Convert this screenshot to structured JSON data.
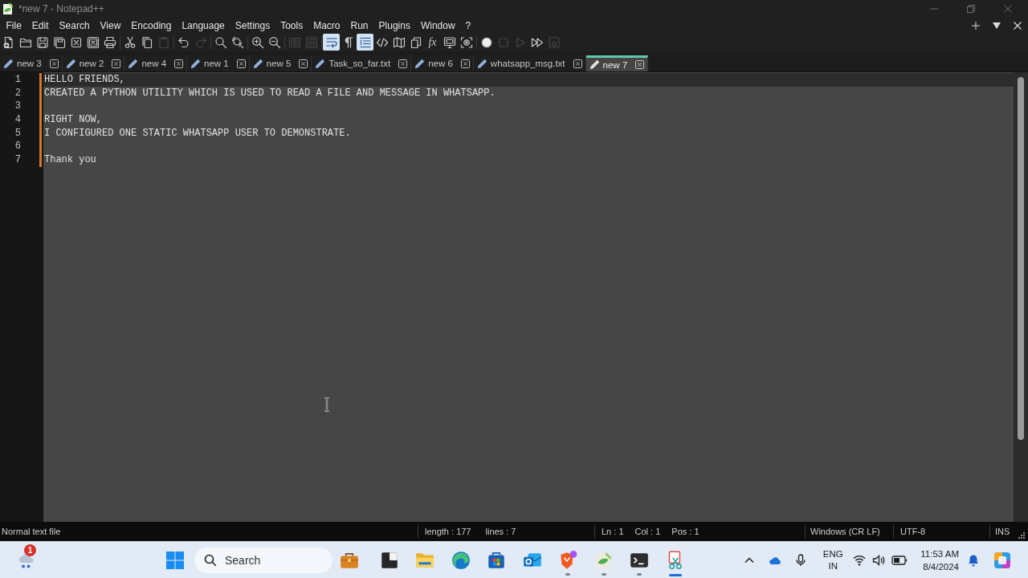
{
  "window": {
    "title": "*new 7 - Notepad++"
  },
  "menu": [
    "File",
    "Edit",
    "Search",
    "View",
    "Encoding",
    "Language",
    "Settings",
    "Tools",
    "Macro",
    "Run",
    "Plugins",
    "Window",
    "?"
  ],
  "toolbar": {
    "groups": [
      {
        "buttons": [
          {
            "kind": "new",
            "on": false,
            "disabled": false
          },
          {
            "kind": "open",
            "on": false,
            "disabled": false
          },
          {
            "kind": "save",
            "on": false,
            "disabled": false
          },
          {
            "kind": "saveall",
            "on": false,
            "disabled": false
          },
          {
            "kind": "close",
            "on": false,
            "disabled": false
          },
          {
            "kind": "closeall",
            "on": false,
            "disabled": false
          },
          {
            "kind": "print",
            "on": false,
            "disabled": false
          }
        ]
      },
      {
        "buttons": [
          {
            "kind": "cut",
            "on": false,
            "disabled": false
          },
          {
            "kind": "copy",
            "on": false,
            "disabled": false
          },
          {
            "kind": "paste",
            "on": false,
            "disabled": true
          }
        ]
      },
      {
        "buttons": [
          {
            "kind": "undo",
            "on": false,
            "disabled": false
          },
          {
            "kind": "redo",
            "on": false,
            "disabled": true
          }
        ]
      },
      {
        "buttons": [
          {
            "kind": "find",
            "on": false,
            "disabled": false
          },
          {
            "kind": "replace",
            "on": false,
            "disabled": false
          }
        ]
      },
      {
        "buttons": [
          {
            "kind": "zoomin",
            "on": false,
            "disabled": false
          },
          {
            "kind": "zoomout",
            "on": false,
            "disabled": false
          }
        ]
      },
      {
        "buttons": [
          {
            "kind": "syncv",
            "on": false,
            "disabled": true
          },
          {
            "kind": "synch",
            "on": false,
            "disabled": true
          }
        ]
      },
      {
        "buttons": [
          {
            "kind": "wrap",
            "on": true,
            "disabled": false
          },
          {
            "kind": "allchars",
            "on": false,
            "disabled": false
          },
          {
            "kind": "indent",
            "on": true,
            "disabled": false
          },
          {
            "kind": "udl",
            "on": false,
            "disabled": false
          },
          {
            "kind": "docmap",
            "on": false,
            "disabled": false
          },
          {
            "kind": "doclist",
            "on": false,
            "disabled": false
          },
          {
            "kind": "funclist",
            "label": "fx",
            "on": false,
            "disabled": false
          },
          {
            "kind": "monitor",
            "on": false,
            "disabled": false
          },
          {
            "kind": "monitoreye",
            "on": false,
            "disabled": false
          }
        ]
      },
      {
        "buttons": [
          {
            "kind": "record",
            "on": false,
            "disabled": false
          },
          {
            "kind": "stop",
            "on": false,
            "disabled": true
          },
          {
            "kind": "play",
            "on": false,
            "disabled": true
          },
          {
            "kind": "playmulti",
            "on": false,
            "disabled": false
          },
          {
            "kind": "savemacro",
            "on": false,
            "disabled": true
          }
        ]
      }
    ]
  },
  "tabs": [
    {
      "label": "new 3",
      "selected": false
    },
    {
      "label": "new 2",
      "selected": false
    },
    {
      "label": "new 4",
      "selected": false
    },
    {
      "label": "new 1",
      "selected": false
    },
    {
      "label": "new 5",
      "selected": false
    },
    {
      "label": "Task_so_far.txt",
      "selected": false
    },
    {
      "label": "new 6",
      "selected": false
    },
    {
      "label": "whatsapp_msg.txt",
      "selected": false
    },
    {
      "label": "new 7",
      "selected": true
    }
  ],
  "editor": {
    "lines": [
      {
        "number": "1",
        "text": "HELLO FRIENDS,",
        "current": true,
        "modified": true
      },
      {
        "number": "2",
        "text": "CREATED A PYTHON UTILITY WHICH IS USED TO READ A FILE AND MESSAGE IN WHATSAPP.",
        "current": false,
        "modified": true
      },
      {
        "number": "3",
        "current": false,
        "modified": true
      },
      {
        "number": "4",
        "text": "RIGHT NOW,",
        "current": false,
        "modified": true
      },
      {
        "number": "5",
        "text": "I CONFIGURED ONE STATIC WHATSAPP USER TO DEMONSTRATE.",
        "current": false,
        "modified": true
      },
      {
        "number": "6",
        "current": false,
        "modified": true
      },
      {
        "number": "7",
        "text": "Thank you",
        "current": false,
        "modified": true
      }
    ]
  },
  "status_bar": {
    "file_type": "Normal text file",
    "length": "length : 177",
    "lines": "lines : 7",
    "ln": "Ln : 1",
    "col": "Col : 1",
    "pos": "Pos : 1",
    "eol": "Windows (CR LF)",
    "encoding": "UTF-8",
    "mode": "INS"
  },
  "taskbar": {
    "widget": {
      "badge": "1"
    },
    "search": {
      "placeholder": "Search"
    },
    "apps": [
      {
        "kind": "briefcase",
        "running": false,
        "active": false
      },
      {
        "kind": "window",
        "running": false,
        "active": false
      },
      {
        "kind": "folder",
        "running": false,
        "active": false
      },
      {
        "kind": "browser",
        "running": false,
        "active": false
      },
      {
        "kind": "store",
        "running": false,
        "active": false
      },
      {
        "kind": "mail",
        "running": false,
        "active": false
      },
      {
        "kind": "shield",
        "running": true,
        "active": false
      },
      {
        "kind": "notepad",
        "running": true,
        "active": false
      },
      {
        "kind": "terminal",
        "running": true,
        "active": false
      },
      {
        "kind": "snip",
        "running": true,
        "active": true
      }
    ],
    "tray": {
      "language": "ENG",
      "region": "IN",
      "time": "11:53 AM",
      "date": "8/4/2024"
    }
  }
}
